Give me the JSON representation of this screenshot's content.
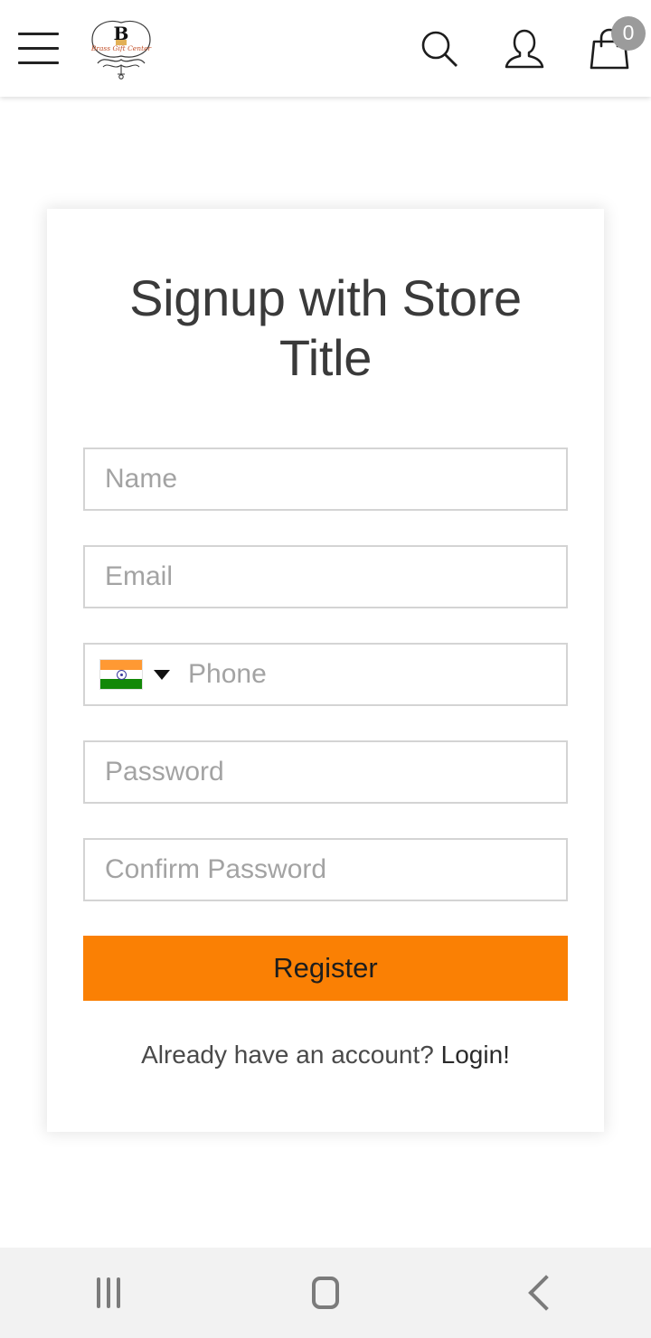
{
  "header": {
    "menu_icon": "hamburger-menu-icon",
    "logo": {
      "monogram": "B",
      "brand_text": "Brass Gift Center"
    },
    "search_icon": "search-icon",
    "account_icon": "user-account-icon",
    "cart_icon": "shopping-bag-icon",
    "cart_count": "0"
  },
  "signup": {
    "title": "Signup with Store Title",
    "fields": {
      "name_placeholder": "Name",
      "email_placeholder": "Email",
      "phone_placeholder": "Phone",
      "password_placeholder": "Password",
      "confirm_password_placeholder": "Confirm Password"
    },
    "country": {
      "flag": "india-flag-icon",
      "caret": "chevron-down-icon"
    },
    "register_label": "Register",
    "login_prompt": "Already have an account?",
    "login_link": "Login!"
  },
  "navbar": {
    "recents_label": "recents-icon",
    "home_label": "home-icon",
    "back_label": "back-icon"
  },
  "colors": {
    "accent_orange": "#FA8004",
    "badge_gray": "#9B9B9B",
    "text_dark": "#3A3A3A",
    "placeholder_gray": "#A3A3A3",
    "field_border": "#D4D4D4",
    "navbar_bg": "#F2F2F2"
  }
}
